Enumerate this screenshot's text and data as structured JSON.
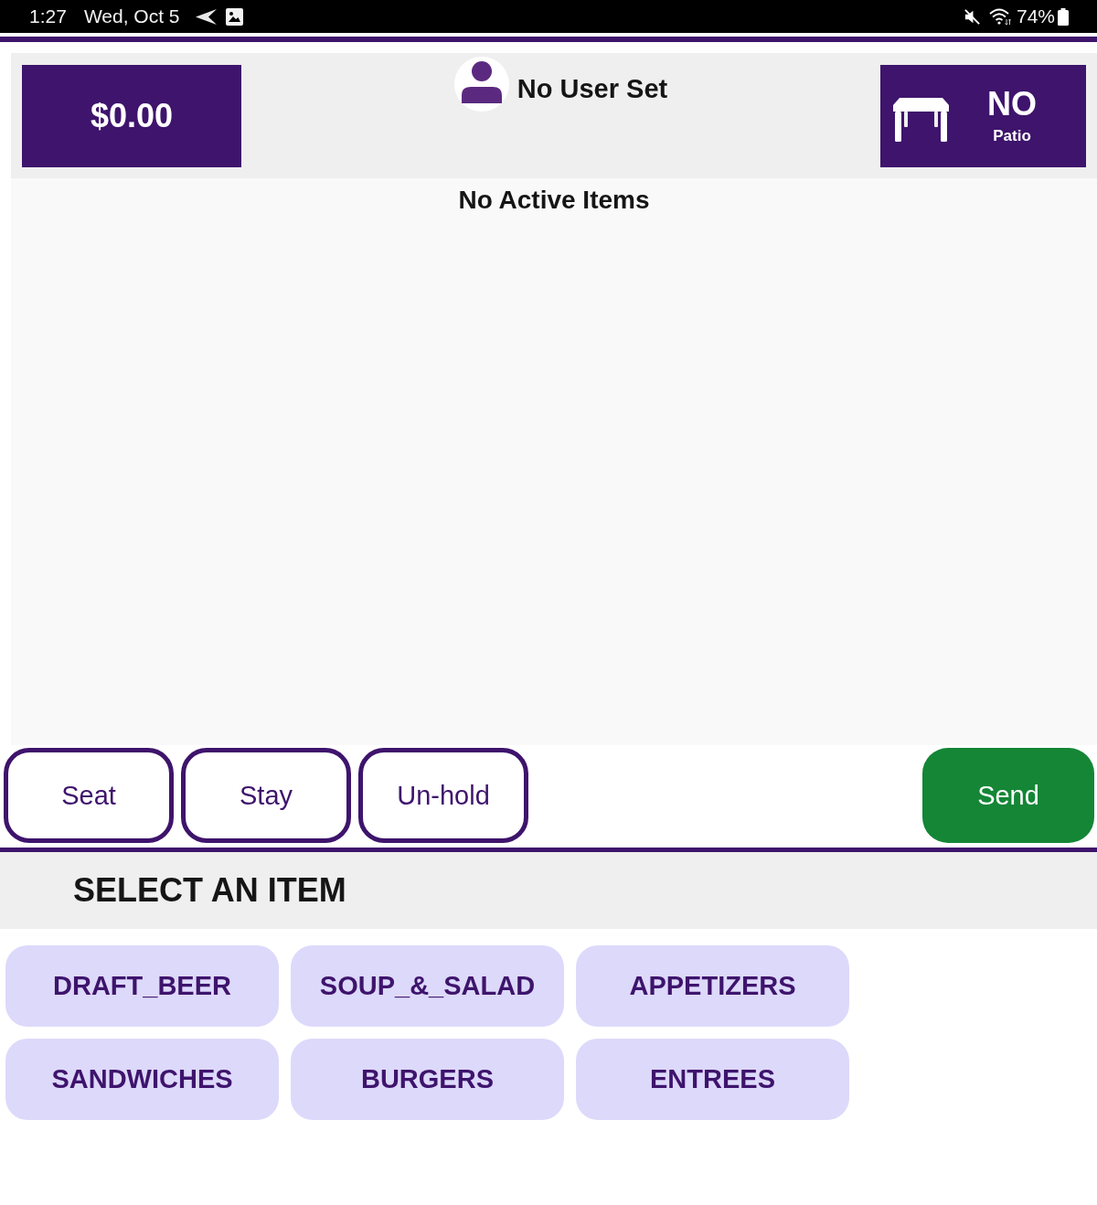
{
  "status_bar": {
    "time": "1:27",
    "date": "Wed, Oct 5",
    "battery": "74%"
  },
  "header": {
    "total": "$0.00",
    "user": "No User Set",
    "table": {
      "number": "NO",
      "area": "Patio"
    }
  },
  "order": {
    "message": "No Active Items"
  },
  "actions": [
    {
      "label": "Seat",
      "kind": "outline"
    },
    {
      "label": "Stay",
      "kind": "outline"
    },
    {
      "label": "Un-hold",
      "kind": "outline"
    },
    {
      "label": "Send",
      "kind": "primary"
    }
  ],
  "menu": {
    "title": "SELECT AN ITEM",
    "categories": [
      "DRAFT_BEER",
      "SOUP_&_SALAD",
      "APPETIZERS",
      "SANDWICHES",
      "BURGERS",
      "ENTREES"
    ]
  }
}
